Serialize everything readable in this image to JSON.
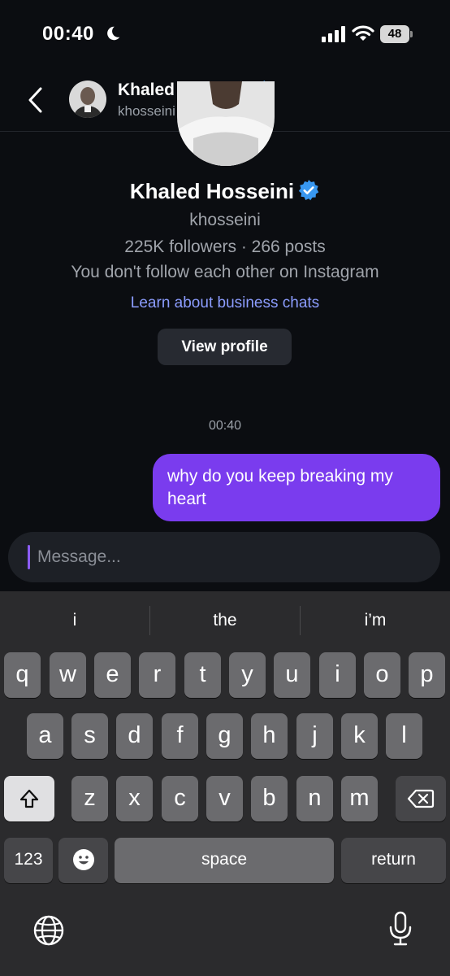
{
  "status_bar": {
    "time": "00:40",
    "battery": "48",
    "icons": [
      "moon-icon",
      "signal-icon",
      "wifi-icon",
      "battery-icon"
    ]
  },
  "header": {
    "name": "Khaled Hosseini",
    "username": "khosseini",
    "icons": [
      "back-icon",
      "verified-icon"
    ]
  },
  "profile": {
    "name": "Khaled Hosseini",
    "username": "khosseini",
    "stats": "225K followers · 266 posts",
    "follow_status": "You don't follow each other on Instagram",
    "learn_link": "Learn about business chats",
    "view_profile_label": "View profile"
  },
  "conversation": {
    "timestamp": "00:40",
    "messages": [
      {
        "text": "why do you keep breaking my heart",
        "sent": true
      }
    ]
  },
  "composer": {
    "placeholder": "Message..."
  },
  "keyboard": {
    "suggestions": [
      "i",
      "the",
      "i’m"
    ],
    "row1": [
      "q",
      "w",
      "e",
      "r",
      "t",
      "y",
      "u",
      "i",
      "o",
      "p"
    ],
    "row2": [
      "a",
      "s",
      "d",
      "f",
      "g",
      "h",
      "j",
      "k",
      "l"
    ],
    "row3": [
      "z",
      "x",
      "c",
      "v",
      "b",
      "n",
      "m"
    ],
    "numbers_label": "123",
    "space_label": "space",
    "return_label": "return",
    "icons": [
      "shift-icon",
      "delete-icon",
      "emoji-icon",
      "globe-icon",
      "microphone-icon"
    ]
  },
  "colors": {
    "bubble": "#7a3cee",
    "link": "#8c9dff",
    "verified": "#3897f0",
    "background": "#0b0d11"
  }
}
